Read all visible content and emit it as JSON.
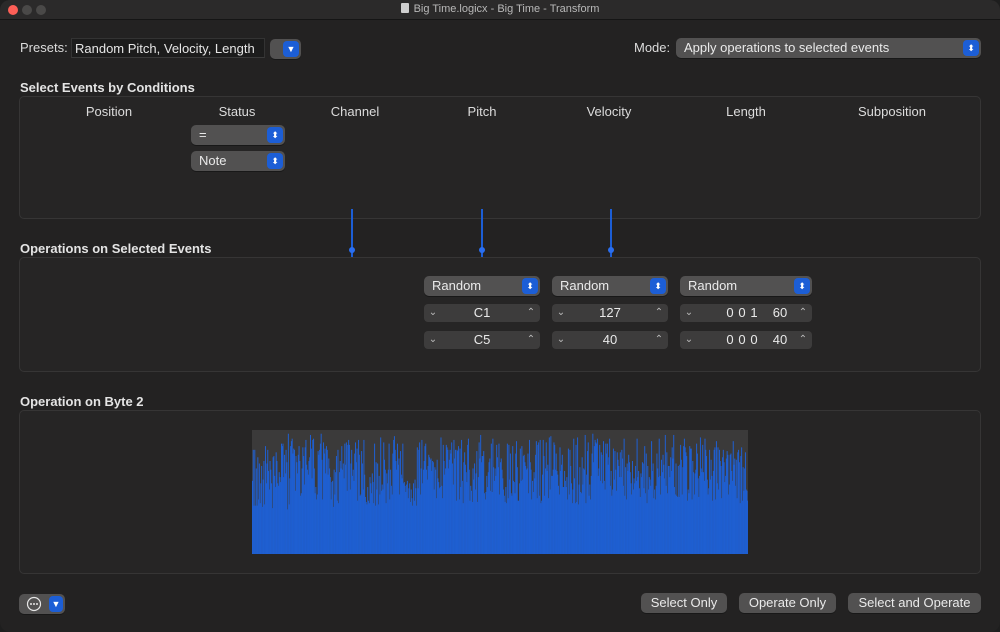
{
  "window": {
    "title": "Big Time.logicx - Big Time - Transform"
  },
  "presets": {
    "label": "Presets:",
    "value": "Random Pitch, Velocity, Length"
  },
  "mode": {
    "label": "Mode:",
    "value": "Apply operations to selected events"
  },
  "conditions": {
    "title": "Select Events by Conditions",
    "columns": [
      "Position",
      "Status",
      "Channel",
      "Pitch",
      "Velocity",
      "Length",
      "Subposition"
    ],
    "status_condition": "=",
    "status_value": "Note"
  },
  "operations": {
    "title": "Operations on Selected Events",
    "pitch": {
      "operation": "Random",
      "value1": "C1",
      "value2": "C5"
    },
    "velocity": {
      "operation": "Random",
      "value1": "127",
      "value2": "40"
    },
    "length": {
      "operation": "Random",
      "value1": [
        "0",
        "0",
        "1",
        "60"
      ],
      "value2": [
        "0",
        "0",
        "0",
        "40"
      ]
    }
  },
  "byte2": {
    "title": "Operation on Byte 2",
    "bars": [
      0.59,
      0.84,
      0.39,
      0.84,
      0.39,
      0.69,
      0.39,
      0.78,
      0.44,
      0.73,
      0.41,
      0.57,
      0.71,
      0.38,
      0.6,
      0.75,
      0.4,
      0.87,
      0.57,
      0.73,
      0.84,
      0.67,
      0.52,
      0.75,
      0.68,
      0.57,
      0.37,
      0.78,
      0.79,
      0.63,
      0.54,
      0.82,
      0.75,
      0.57,
      0.55,
      0.66,
      0.62,
      0.58,
      0.89,
      0.87,
      0.89,
      0.62,
      0.8,
      0.65,
      0.84,
      0.74,
      0.36,
      0.97,
      0.4,
      0.61,
      0.87,
      0.91,
      0.93,
      0.81,
      0.85,
      0.84,
      0.51,
      0.79,
      0.74,
      0.65,
      0.8,
      0.87,
      0.75,
      0.47,
      0.49,
      0.69,
      0.86,
      0.79,
      0.56,
      0.86,
      0.92,
      0.72,
      0.68,
      0.64,
      0.75,
      0.78,
      0.96,
      0.85,
      0.61,
      0.92,
      0.93,
      0.69,
      0.49,
      0.54,
      0.44,
      0.48,
      0.83,
      0.8,
      0.84,
      0.89,
      0.97,
      0.76,
      0.44,
      0.9,
      0.81,
      0.85,
      0.65,
      0.87,
      0.84,
      0.64,
      0.77,
      0.69,
      0.62,
      0.44,
      0.58,
      0.59,
      0.38,
      0.68,
      0.48,
      0.66,
      0.79,
      0.43,
      0.84,
      0.41,
      0.66,
      0.75,
      0.69,
      0.87,
      0.68,
      0.73,
      0.61,
      0.89,
      0.72,
      0.9,
      0.51,
      0.88,
      0.92,
      0.88,
      0.52,
      0.73,
      0.84,
      0.63,
      0.68,
      0.59,
      0.81,
      0.9,
      0.74,
      0.85,
      0.43,
      0.92,
      0.8,
      0.47,
      0.48,
      0.83,
      0.73,
      0.52,
      0.92,
      0.64,
      0.46,
      0.42,
      0.4,
      0.54,
      0.43,
      0.41,
      0.62,
      0.57,
      0.49,
      0.65,
      0.58,
      0.41,
      0.89,
      0.39,
      0.74,
      0.52,
      0.73,
      0.4,
      0.63,
      0.48,
      0.94,
      0.51,
      0.56,
      0.52,
      0.9,
      0.76,
      0.68,
      0.41,
      0.65,
      0.57,
      0.68,
      0.89,
      0.44,
      0.68,
      0.55,
      0.48,
      0.81,
      0.92,
      0.95,
      0.84,
      0.75,
      0.68,
      0.89,
      0.72,
      0.77,
      0.48,
      0.83,
      0.64,
      0.61,
      0.89,
      0.57,
      0.58,
      0.55,
      0.5,
      0.56,
      0.59,
      0.45,
      0.53,
      0.57,
      0.42,
      0.52,
      0.45,
      0.39,
      0.57,
      0.43,
      0.6,
      0.53,
      0.39,
      0.86,
      0.53,
      0.84,
      0.9,
      0.48,
      0.69,
      0.92,
      0.57,
      0.68,
      0.75,
      0.87,
      0.89,
      0.68,
      0.6,
      0.71,
      0.8,
      0.78,
      0.76,
      0.77,
      0.67,
      0.75,
      0.74,
      0.52,
      0.7,
      0.68,
      0.45,
      0.76,
      0.61,
      0.58,
      0.53,
      0.54,
      0.94,
      0.55,
      0.45,
      0.88,
      0.75,
      0.64,
      0.69,
      0.88,
      0.86,
      0.84,
      0.69,
      0.76,
      0.84,
      0.81,
      0.9,
      0.73,
      0.56,
      0.92,
      0.77,
      0.84,
      0.43,
      0.84,
      0.83,
      0.87,
      0.44,
      0.85,
      0.54,
      0.92,
      0.59,
      0.41,
      0.74,
      0.82,
      0.72,
      0.66,
      0.58,
      0.88,
      0.93,
      0.68,
      0.43,
      0.55,
      0.51,
      0.42,
      0.69,
      0.6,
      0.73,
      0.52,
      0.65,
      0.83,
      0.42,
      0.62,
      0.9,
      0.77,
      0.96,
      0.74,
      0.79,
      0.79,
      0.83,
      0.49,
      0.44,
      0.5,
      0.63,
      0.54,
      0.66,
      0.74,
      0.77,
      0.51,
      0.89,
      0.5,
      0.93,
      0.7,
      0.59,
      0.69,
      0.63,
      0.88,
      0.78,
      0.7,
      0.89,
      0.48,
      0.74,
      0.77,
      0.68,
      0.61,
      0.52,
      0.47,
      0.42,
      0.54,
      0.41,
      0.89,
      0.45,
      0.88,
      0.6,
      0.81,
      0.49,
      0.47,
      0.87,
      0.59,
      0.58,
      0.49,
      0.81,
      0.91,
      0.7,
      0.43,
      0.43,
      0.57,
      0.85,
      0.59,
      0.87,
      0.6,
      0.79,
      0.8,
      0.74,
      0.71,
      0.68,
      0.69,
      0.81,
      0.49,
      0.92,
      0.74,
      0.68,
      0.44,
      0.59,
      0.5,
      0.66,
      0.61,
      0.8,
      0.91,
      0.45,
      0.88,
      0.9,
      0.47,
      0.92,
      0.41,
      0.43,
      0.64,
      0.92,
      0.79,
      0.47,
      0.69,
      0.9,
      0.67,
      0.72,
      0.45,
      0.94,
      0.52,
      0.95,
      0.63,
      0.63,
      0.68,
      0.9,
      0.88,
      0.68,
      0.81,
      0.67,
      0.64,
      0.55,
      0.48,
      0.86,
      0.67,
      0.72,
      0.8,
      0.54,
      0.54,
      0.67,
      0.59,
      0.54,
      0.62,
      0.44,
      0.85,
      0.48,
      0.84,
      0.71,
      0.57,
      0.41,
      0.52,
      0.93,
      0.61,
      0.41,
      0.88,
      0.42,
      0.94,
      0.4,
      0.56,
      0.7,
      0.5,
      0.49,
      0.78,
      0.56,
      0.69,
      0.68,
      0.96,
      0.41,
      0.64,
      0.83,
      0.9,
      0.47,
      0.56,
      0.44,
      0.63,
      0.81,
      0.97,
      0.74,
      0.87,
      0.92,
      0.9,
      0.89,
      0.93,
      0.63,
      0.69,
      0.88,
      0.59,
      0.82,
      0.8,
      0.57,
      0.91,
      0.59,
      0.52,
      0.89,
      0.81,
      0.89,
      0.72,
      0.78,
      0.93,
      0.55,
      0.67,
      0.47,
      0.52,
      0.85,
      0.6,
      0.83,
      0.68,
      0.51,
      0.82,
      0.76,
      0.71,
      0.62,
      0.82,
      0.62,
      0.84,
      0.77,
      0.55,
      0.93,
      0.47,
      0.7,
      0.44,
      0.73,
      0.67,
      0.8,
      0.74,
      0.66,
      0.57,
      0.48,
      0.75,
      0.52,
      0.61,
      0.57,
      0.71,
      0.59,
      0.93,
      0.62,
      0.67,
      0.53,
      0.46,
      0.65,
      0.62,
      0.74,
      0.73,
      0.53,
      0.87,
      0.49,
      0.81,
      0.41,
      0.71,
      0.52,
      0.62,
      0.6,
      0.55,
      0.91,
      0.67,
      0.73,
      0.45,
      0.52,
      0.44,
      0.55,
      0.81,
      0.69,
      0.62,
      0.93,
      0.63,
      0.48,
      0.76,
      0.66,
      0.8,
      0.72,
      0.61,
      0.96,
      0.55,
      0.82,
      0.49,
      0.71,
      0.71,
      0.62,
      0.78,
      0.67,
      0.86,
      0.77,
      0.96,
      0.54,
      0.48,
      0.73,
      0.47,
      0.46,
      0.71,
      0.46,
      0.72,
      0.88,
      0.76,
      0.48,
      0.7,
      0.87,
      0.93,
      0.86,
      0.82,
      0.79,
      0.43,
      0.52,
      0.49,
      0.87,
      0.85,
      0.85,
      0.44,
      0.75,
      0.66,
      0.48,
      0.65,
      0.68,
      0.89,
      0.81,
      0.61,
      0.46,
      0.63,
      0.94,
      0.69,
      0.66,
      0.88,
      0.66,
      0.59,
      0.93,
      0.84,
      0.79,
      0.6,
      0.48,
      0.53,
      0.84,
      0.6,
      0.76,
      0.63,
      0.43,
      0.67,
      0.84,
      0.86,
      0.44,
      0.91,
      0.57,
      0.86,
      0.52,
      0.84,
      0.75,
      0.71,
      0.45,
      0.78,
      0.84,
      0.74,
      0.58,
      0.63,
      0.77,
      0.83,
      0.8,
      0.48,
      0.56,
      0.8,
      0.81,
      0.67,
      0.59,
      0.91,
      0.72,
      0.77,
      0.55,
      0.76,
      0.45,
      0.82,
      0.84,
      0.74,
      0.41,
      0.79,
      0.86,
      0.43,
      0.7,
      0.51,
      0.69,
      0.82,
      0.52,
      0.51,
      0.43
    ]
  },
  "footer": {
    "select_only": "Select Only",
    "operate_only": "Operate Only",
    "select_and_operate": "Select and Operate"
  },
  "colors": {
    "accent": "#1c5ed6",
    "bar": "#1f5fd1",
    "close": "#fe5f57"
  }
}
